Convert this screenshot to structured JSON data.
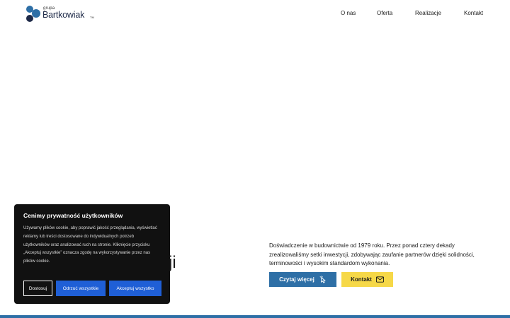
{
  "header": {
    "logo_small": "grupa",
    "logo_big": "Bartkowiak",
    "logo_tm": "TM",
    "nav": [
      {
        "label": "O nas"
      },
      {
        "label": "Oferta"
      },
      {
        "label": "Realizacje"
      },
      {
        "label": "Kontakt"
      }
    ]
  },
  "hero": {
    "partial_heading": "ji",
    "description": "Doświadczenie w budownictwie od 1979 roku. Przez ponad cztery dekady zrealizowaliśmy setki inwestycji, zdobywając zaufanie partnerów dzięki solidności, terminowości i wysokim standardom wykonania.",
    "read_more_label": "Czytaj więcej",
    "contact_label": "Kontakt",
    "read_more_icon": "pointer-click-icon",
    "contact_icon": "envelope-icon"
  },
  "cookie": {
    "title": "Cenimy prywatność użytkowników",
    "text": "Używamy plików cookie, aby poprawić jakość przeglądania, wyświetlać reklamy lub treści dostosowane do indywidualnych potrzeb użytkowników oraz analizować ruch na stronie. Kliknięcie przycisku „Akceptuj wszystkie” oznacza zgodę na wykorzystywanie przez nas plików cookie.",
    "customize_label": "Dostosuj",
    "reject_label": "Odrzuć wszystkie",
    "accept_label": "Akceptuj wszystko"
  },
  "colors": {
    "primary_blue": "#2e6fa6",
    "accent_yellow": "#f6d848",
    "cookie_bg": "#111111",
    "cookie_button_blue": "#1f5fd6",
    "logo_navy": "#1e2a48"
  }
}
